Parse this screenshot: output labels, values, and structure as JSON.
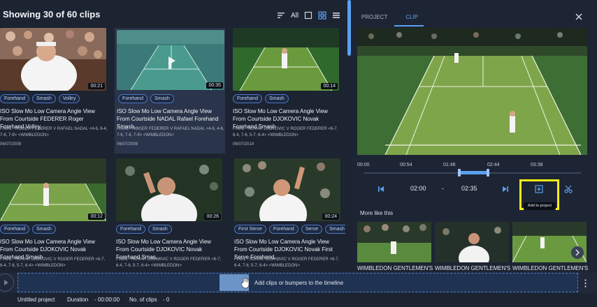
{
  "header": {
    "title": "Showing 30 of 60 clips",
    "all_label": "All"
  },
  "clips": [
    {
      "tags": [
        "Forehand",
        "Smash",
        "Volley"
      ],
      "duration": "00:21",
      "title": "ISO Slow Mo Low Camera Angle View From Courtside FEDERER Roger Forehand Volley...",
      "desc": "FINAL - ROGER FEDERER V RAFAEL NADAL <4-6, 6-4, 7-6, 7-9> <WIMBLEDON>",
      "date": "06/07/2008"
    },
    {
      "tags": [
        "Forehand",
        "Smash"
      ],
      "duration": "00:35",
      "title": "ISO Slow Mo Low Camera Angle View From Courtside NADAL Rafael Forehand Smash...",
      "desc": "FINAL - ROGER FEDERER V RAFAEL NADAL <4-6, 4-6, 7-6, 7-6, 7-9> <WIMBLEDON>",
      "date": "06/07/2008"
    },
    {
      "tags": [
        "Forehand",
        "Smash"
      ],
      "duration": "00:14",
      "title": "ISO Slow Mo Low Camera Angle View From Courtside DJOKOVIC Novak Forehand Smash",
      "desc": "FINAL - NOVAK DJOKOVIC V ROGER FEDERER <6-7, 6-4, 7-6, 5-7, 6-4> <WIMBLEDON>",
      "date": "06/07/2014"
    },
    {
      "tags": [
        "Forehand",
        "Smash"
      ],
      "duration": "00:12",
      "title": "ISO Slow Mo Low Camera Angle View From Courtside DJOKOVIC Novak Forehand Smash",
      "desc": "FINAL - NOVAK DJOKOVIC V ROGER FEDERER <6-7, 6-4, 7-6, 5-7, 6-4> <WIMBLEDON>",
      "date": ""
    },
    {
      "tags": [
        "Forehand",
        "Smash"
      ],
      "duration": "00:26",
      "title": "ISO Slow Mo Low Camera Angle View From Courtside DJOKOVIC Novak Forehand Smas...",
      "desc": "FINAL - NOVAK DJOKOVIC V ROGER FEDERER <6-7, 6-4, 7-6, 5-7, 6-4> <WIMBLEDON>",
      "date": ""
    },
    {
      "tags": [
        "First Serve",
        "Forehand",
        "Serve",
        "Smash"
      ],
      "duration": "00:24",
      "title": "ISO Slow Mo Low Camera Angle View From Courtside DJOKOVIC Novak First Serve Forehand...",
      "desc": "FINAL - NOVAK DJOKOVIC V ROGER FEDERER <6-7, 6-4, 7-6, 5-7, 6-4> <WIMBLEDON>",
      "date": ""
    }
  ],
  "panel": {
    "tabs": [
      "PROJECT",
      "CLIP"
    ],
    "ticks": [
      "00:00",
      "00:54",
      "01:48",
      "02:44",
      "03:38"
    ],
    "start": "02:00",
    "sep": "-",
    "end": "02:35",
    "tooltip": "Add to project",
    "more_label": "More like this",
    "more_captions": [
      "WIMBLEDON GENTLEMEN'S",
      "WIMBLEDON GENTLEMEN'S",
      "WIMBLEDON GENTLEMEN'S"
    ]
  },
  "timeline": {
    "drop_text": "Add clips or bumpers to the timeline"
  },
  "status": {
    "project": "Untitled project",
    "duration_label": "Duration",
    "duration_value": "- 00:00:00",
    "clips_label": "No. of clips",
    "clips_value": "- 0"
  },
  "colors": {
    "accent": "#5aa0f0",
    "highlight": "#f1ef14",
    "background": "#1c2331"
  }
}
